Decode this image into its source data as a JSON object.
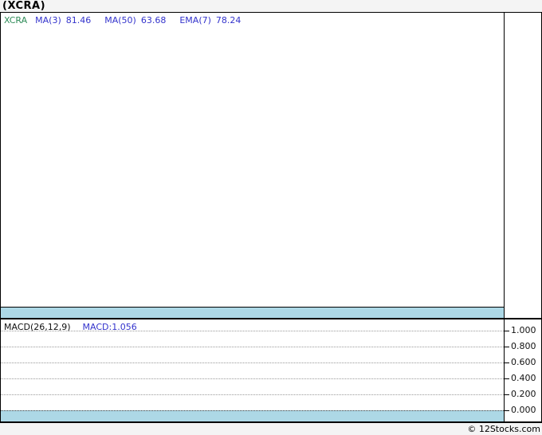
{
  "page": {
    "title": "(XCRA)",
    "watermark": "© 12Stocks.com"
  },
  "colors": {
    "symbol_green": "#2e8b57",
    "indicator_blue": "#3333cc",
    "band_blue": "#add8e6",
    "page_background": "#f4f4f4",
    "panel_background": "#ffffff",
    "border_black": "#000000"
  },
  "main_chart": {
    "legend": {
      "symbol": "XCRA",
      "items": [
        {
          "label": "MA(3)",
          "value": "81.46"
        },
        {
          "label": "MA(50)",
          "value": "63.68"
        },
        {
          "label": "EMA(7)",
          "value": "78.24"
        }
      ]
    }
  },
  "macd_chart": {
    "legend": {
      "params": "MACD(26,12,9)",
      "value": "MACD:1.056"
    },
    "axis": {
      "ticks": [
        "1.000",
        "0.800",
        "0.600",
        "0.400",
        "0.200",
        "0.000"
      ]
    }
  },
  "chart_data": [
    {
      "type": "line",
      "title": "(XCRA)",
      "series": [
        {
          "name": "XCRA",
          "values": []
        },
        {
          "name": "MA(3)",
          "values": [
            81.46
          ]
        },
        {
          "name": "MA(50)",
          "values": [
            63.68
          ]
        },
        {
          "name": "EMA(7)",
          "values": [
            78.24
          ]
        }
      ],
      "legend_position": "top-left",
      "grid": false
    },
    {
      "type": "line",
      "title": "MACD(26,12,9)",
      "series": [
        {
          "name": "MACD",
          "values": [
            1.056
          ]
        }
      ],
      "ylim": [
        0.0,
        1.0
      ],
      "yticks": [
        1.0,
        0.8,
        0.6,
        0.4,
        0.2,
        0.0
      ],
      "legend_position": "top-left",
      "grid": true
    }
  ]
}
